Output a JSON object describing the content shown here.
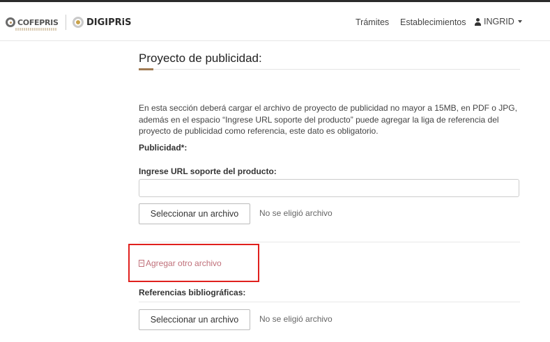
{
  "brand": {
    "cofepris": "COFEPRIS",
    "digipris": "DIGIPRiS"
  },
  "nav": {
    "tramites": "Trámites",
    "establecimientos": "Establecimientos",
    "user": "INGRID"
  },
  "page": {
    "title": "Proyecto de publicidad:",
    "description": "En esta sección deberá cargar el archivo de proyecto de publicidad no mayor a 15MB, en PDF o JPG, además en el espacio “Ingrese URL soporte del producto” puede agregar la liga de referencia del proyecto de publicidad como referencia, este dato es obligatorio.",
    "publicidad_label": "Publicidad*:",
    "url_label": "Ingrese URL soporte del producto:",
    "url_value": "",
    "file1_button": "Seleccionar un archivo",
    "file1_status": "No se eligió archivo",
    "add_file_link": "Agregar otro archivo",
    "referencias_label": "Referencias bibliográficas:",
    "file2_button": "Seleccionar un archivo",
    "file2_status": "No se eligió archivo"
  },
  "colors": {
    "accent_gold": "#a07a52",
    "link_pink": "#c0707a",
    "highlight_red": "#e0201d"
  }
}
